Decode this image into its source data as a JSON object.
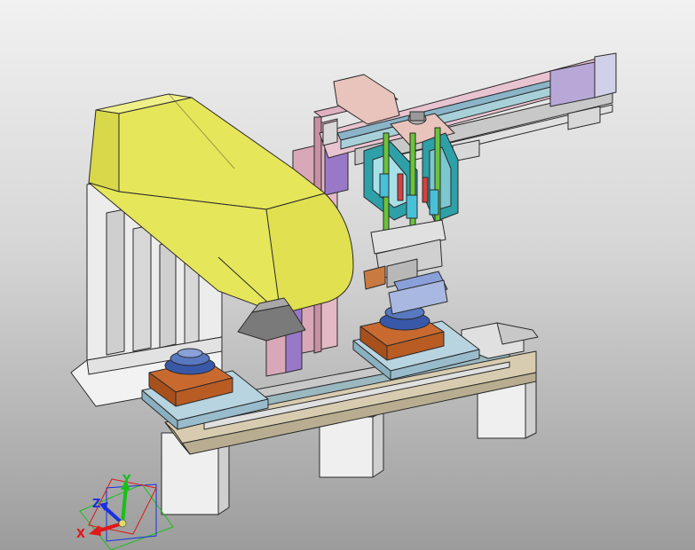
{
  "viewport": {
    "background_top": "#f1f1f1",
    "background_bottom": "#9c9c9c"
  },
  "triad": {
    "x_label": "X",
    "y_label": "Y",
    "z_label": "Z",
    "x_color": "#e01818",
    "y_color": "#18c018",
    "z_color": "#1830e0"
  },
  "colors": {
    "laser_housing": "#e6e65a",
    "frame_pink": "#d9a8b8",
    "frame_purple": "#9a78c8",
    "teal_bracket": "#2ea0a8",
    "base_beige": "#d8ccb0",
    "fixture_plate": "#b8d4e0",
    "fixture_copper": "#c86a30",
    "part_blue": "#5878c0",
    "legs": "#e8e8e8"
  }
}
